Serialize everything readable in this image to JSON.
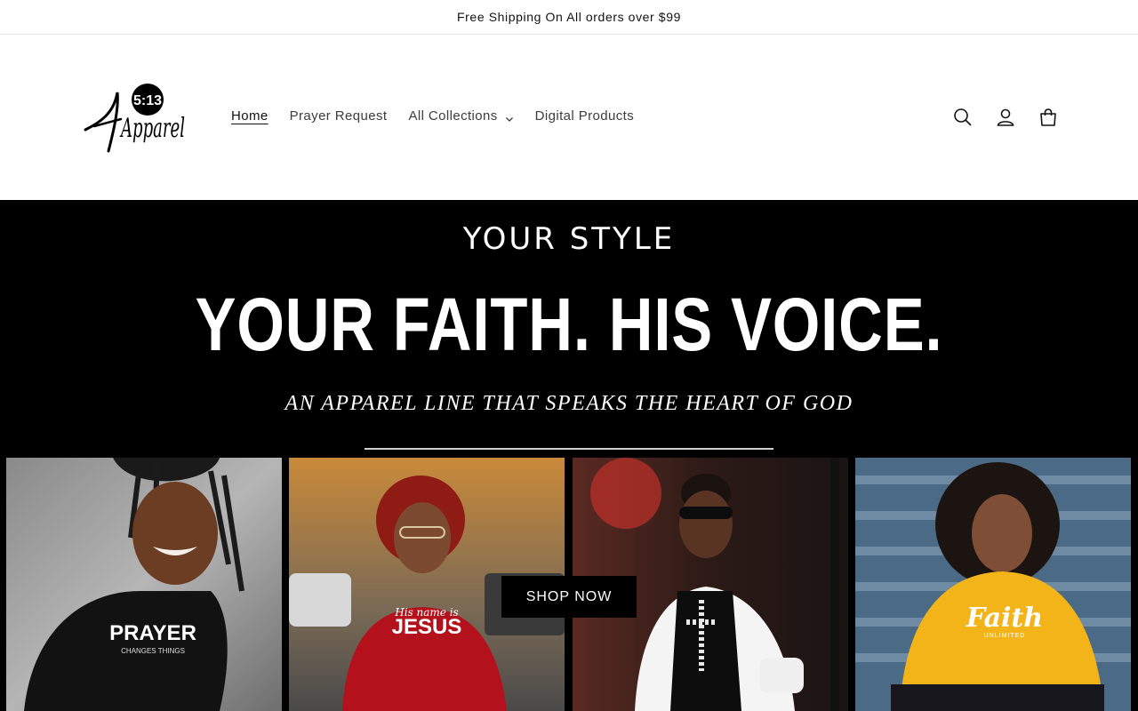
{
  "announcement": {
    "text": "Free Shipping On All orders over $99"
  },
  "logo": {
    "badge": "5:13",
    "wordmark": "Apparel"
  },
  "nav": {
    "items": [
      {
        "label": "Home",
        "active": true
      },
      {
        "label": "Prayer Request"
      },
      {
        "label": "All Collections",
        "has_dropdown": true
      },
      {
        "label": "Digital Products"
      }
    ]
  },
  "header_icons": [
    "search-icon",
    "account-icon",
    "cart-icon"
  ],
  "hero": {
    "kicker": "YOUR STYLE",
    "title": "YOUR FAITH. HIS VOICE.",
    "subtitle": "AN APPAREL LINE THAT SPEAKS THE HEART OF GOD",
    "cta": "SHOP NOW",
    "photos": [
      {
        "shirt_text": "PRAYER",
        "shirt_subtext": "CHANGES THINGS",
        "shirt_color": "#111111"
      },
      {
        "shirt_text": "JESUS",
        "shirt_subtext": "His name is",
        "shirt_color": "#b3121c"
      },
      {
        "shirt_text": "",
        "shirt_subtext": "",
        "shirt_color": "#0d0d0d"
      },
      {
        "shirt_text": "Faith",
        "shirt_subtext": "UNLIMITED",
        "shirt_color": "#f2b418"
      }
    ]
  },
  "colors": {
    "hero_bg": "#000000",
    "text": "#121212",
    "nav_text": "#3c3c3c"
  }
}
